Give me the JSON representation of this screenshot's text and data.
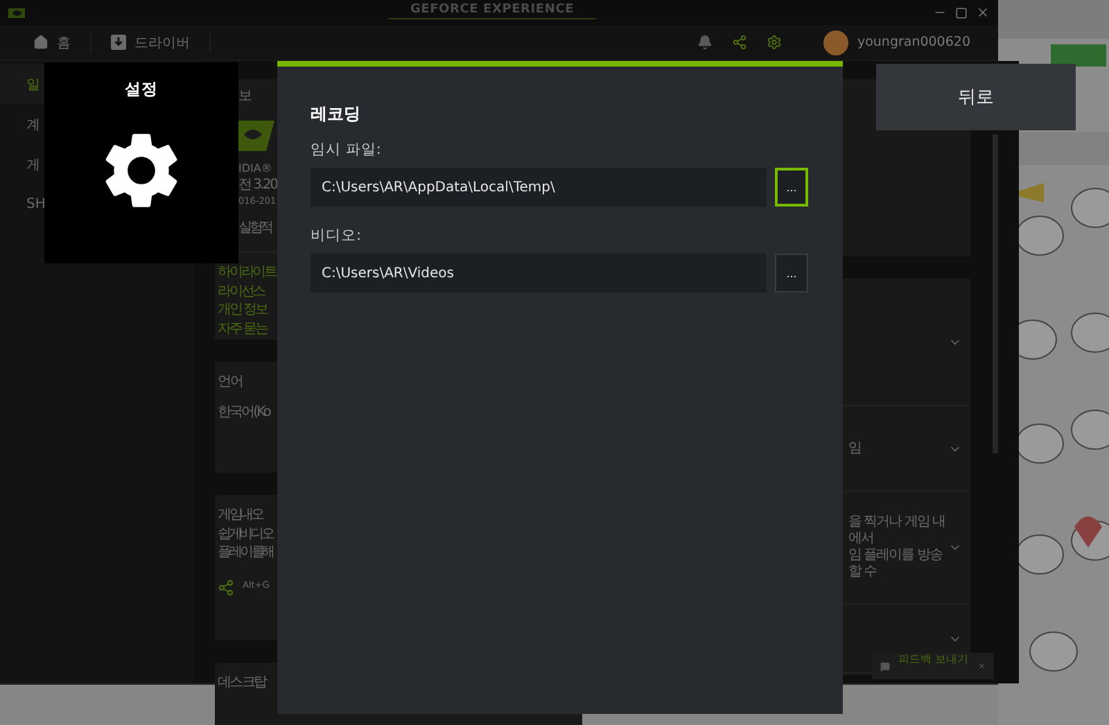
{
  "title_bar": {
    "title": "GEFORCE EXPERIENCE"
  },
  "nav": {
    "items": [
      {
        "label": "홈",
        "kind": "home"
      },
      {
        "label": "드라이버",
        "kind": "driver"
      }
    ],
    "username": "youngran000620"
  },
  "sidebar": {
    "items": [
      {
        "label": "일",
        "selected": true
      },
      {
        "label": "계",
        "selected": false
      },
      {
        "label": "게",
        "selected": false
      },
      {
        "label": "SH",
        "selected": false
      }
    ]
  },
  "about_card": {
    "heading": "보",
    "lines": [
      "IDIA®",
      "전 3.20",
      "016-201"
    ],
    "option": "실험적",
    "links": [
      "하이라이트",
      "라이선스",
      "개인 정보",
      "자주 묻는"
    ]
  },
  "language_card": {
    "heading": "언어",
    "value": "한국어 (Ko"
  },
  "overlay_card": {
    "heading": "게임 내 오",
    "lines": [
      "쉽게 비디오",
      "플레이를 해"
    ],
    "shortcut": "Alt+G"
  },
  "desktop_card": {
    "heading": "데스크탑"
  },
  "feature_rows": [
    {
      "lines": []
    },
    {
      "lines": [
        "임"
      ]
    },
    {
      "lines": [
        "을 찍거나 게임 내에서",
        "임 플레이를 방송할 수"
      ]
    },
    {
      "lines": []
    }
  ],
  "feedback": {
    "label": "피드백 보내기"
  },
  "settings_tile": {
    "title": "설정"
  },
  "dialog": {
    "heading": "레코딩",
    "fields": [
      {
        "label": "임시 파일:",
        "value": "C:\\Users\\AR\\AppData\\Local\\Temp\\",
        "button": "...",
        "focused": true
      },
      {
        "label": "비디오:",
        "value": "C:\\Users\\AR\\Videos",
        "button": "...",
        "focused": false
      }
    ]
  },
  "back_button": {
    "label": "뒤로"
  }
}
